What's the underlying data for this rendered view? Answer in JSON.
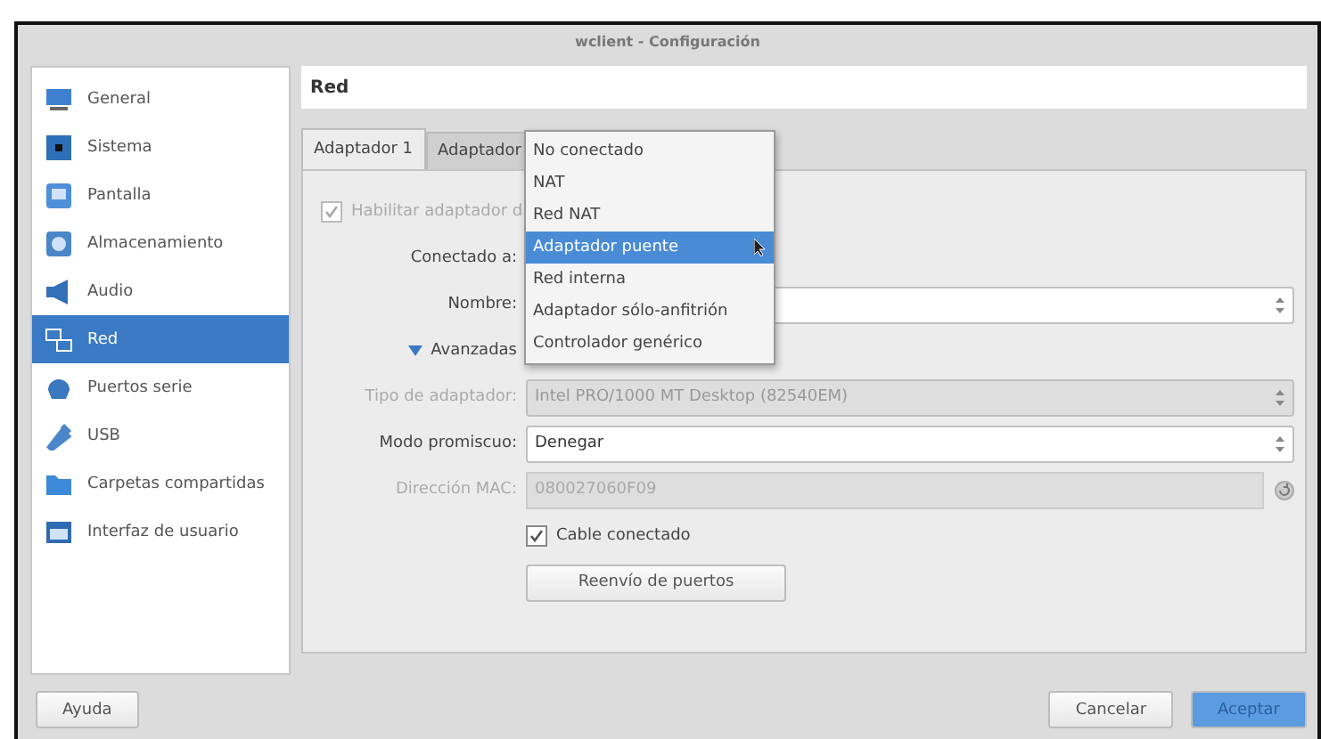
{
  "window": {
    "title": "wclient - Configuración"
  },
  "sidebar": {
    "items": [
      {
        "label": "General",
        "kind": "monitor",
        "selected": false
      },
      {
        "label": "Sistema",
        "kind": "chip",
        "selected": false
      },
      {
        "label": "Pantalla",
        "kind": "display",
        "selected": false
      },
      {
        "label": "Almacenamiento",
        "kind": "disk",
        "selected": false
      },
      {
        "label": "Audio",
        "kind": "speaker",
        "selected": false
      },
      {
        "label": "Red",
        "kind": "network",
        "selected": true
      },
      {
        "label": "Puertos serie",
        "kind": "serial",
        "selected": false
      },
      {
        "label": "USB",
        "kind": "usb",
        "selected": false
      },
      {
        "label": "Carpetas compartidas",
        "kind": "folder",
        "selected": false
      },
      {
        "label": "Interfaz de usuario",
        "kind": "window",
        "selected": false
      }
    ]
  },
  "page_title": "Red",
  "tabs": [
    {
      "label": "Adaptador 1",
      "selected": true
    },
    {
      "label": "Adaptador",
      "selected": false
    }
  ],
  "form": [
    {
      "kind": "wide-checkbox",
      "label": "Habilitar adaptador d",
      "checked": true,
      "disabled": true
    },
    {
      "kind": "label",
      "label": "Conectado a:"
    },
    {
      "kind": "combo",
      "label": "Nombre:",
      "disabled": false
    },
    {
      "kind": "toggle",
      "label": "Avanzadas",
      "expanded": true
    },
    {
      "kind": "combo",
      "label": "Tipo de adaptador:",
      "value": "Intel PRO/1000 MT Desktop (82540EM)",
      "disabled": true
    },
    {
      "kind": "combo",
      "label": "Modo promiscuo:",
      "value": "Denegar",
      "disabled": false
    },
    {
      "kind": "mac",
      "label": "Dirección MAC:",
      "value": "080027060F09",
      "disabled": true
    },
    {
      "kind": "checkbox",
      "label": "Cable conectado",
      "checked": true,
      "disabled": false
    },
    {
      "kind": "button",
      "label": "Reenvío de puertos"
    }
  ],
  "dropdown": {
    "options": [
      {
        "label": "No conectado",
        "selected": false
      },
      {
        "label": "NAT",
        "selected": false
      },
      {
        "label": "Red NAT",
        "selected": false
      },
      {
        "label": "Adaptador puente",
        "selected": true
      },
      {
        "label": "Red interna",
        "selected": false
      },
      {
        "label": "Adaptador sólo-anfitrión",
        "selected": false
      },
      {
        "label": "Controlador genérico",
        "selected": false
      }
    ]
  },
  "buttons": [
    {
      "label": "Ayuda",
      "kind": "help"
    },
    {
      "label": "Cancelar",
      "kind": "cancel"
    },
    {
      "label": "Aceptar",
      "kind": "default"
    }
  ]
}
